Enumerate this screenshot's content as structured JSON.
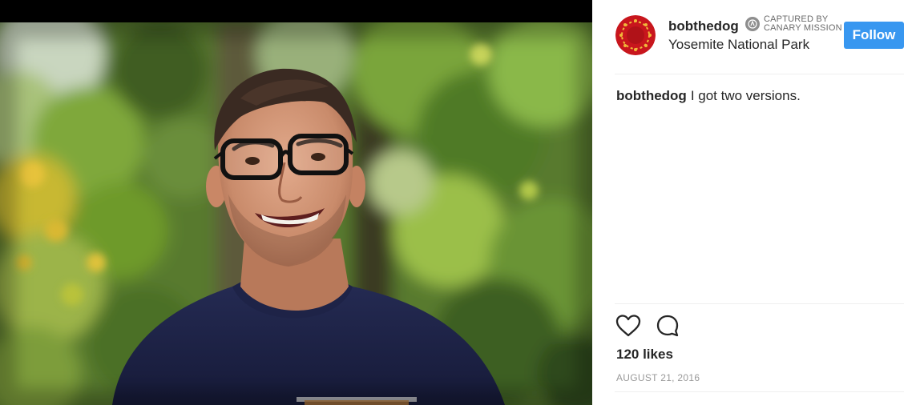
{
  "post": {
    "username": "bobthedog",
    "captured_by_line1": "CAPTURED BY",
    "captured_by_line2": "CANARY MISSION",
    "location": "Yosemite National Park",
    "follow_label": "Follow",
    "caption_user": "bobthedog",
    "caption_text": "I got two versions.",
    "likes": "120 likes",
    "date": "AUGUST 21, 2016"
  },
  "icons": {
    "like": "heart-icon",
    "comment": "comment-icon",
    "captured_badge": "canary-badge-icon"
  },
  "colors": {
    "follow_button": "#3897f0",
    "avatar": "#c8161d",
    "text": "#262626",
    "muted": "#999999"
  }
}
